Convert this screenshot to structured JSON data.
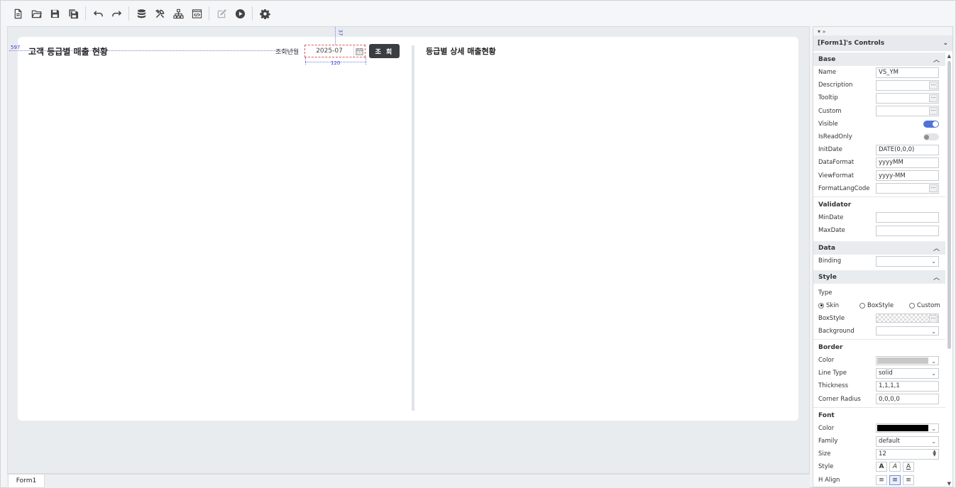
{
  "toolbar": {
    "buttons": [
      {
        "name": "new-file",
        "icon": "new-file-icon"
      },
      {
        "name": "open",
        "icon": "folder-open-icon"
      },
      {
        "name": "save",
        "icon": "save-icon"
      },
      {
        "name": "save-all",
        "icon": "save-all-icon"
      },
      {
        "name": "undo",
        "icon": "undo-icon"
      },
      {
        "name": "redo",
        "icon": "redo-icon"
      },
      {
        "name": "database",
        "icon": "database-icon"
      },
      {
        "name": "tools",
        "icon": "tools-icon"
      },
      {
        "name": "hierarchy",
        "icon": "hierarchy-icon"
      },
      {
        "name": "code-view",
        "icon": "code-window-icon"
      },
      {
        "name": "edit",
        "icon": "edit-icon"
      },
      {
        "name": "run",
        "icon": "play-icon"
      },
      {
        "name": "settings",
        "icon": "gear-icon"
      }
    ]
  },
  "canvas": {
    "left_title": "고객 등급별 매출 현황",
    "right_title": "등급별 상세 매출현황",
    "search_label": "조회년월",
    "date_value": "2025-07",
    "search_button": "조 회",
    "guide_left": "597",
    "guide_top": "37",
    "guide_width": "120"
  },
  "tabs": [
    {
      "label": "Form1"
    }
  ],
  "properties": {
    "pin_text": "▾ »",
    "header": "[Form1]'s Controls",
    "base": {
      "title": "Base",
      "name_label": "Name",
      "name_value": "VS_YM",
      "description_label": "Description",
      "tooltip_label": "Tooltip",
      "custom_label": "Custom",
      "visible_label": "Visible",
      "readonly_label": "IsReadOnly",
      "initdate_label": "InitDate",
      "initdate_value": "DATE(0,0,0)",
      "dataformat_label": "DataFormat",
      "dataformat_value": "yyyyMM",
      "viewformat_label": "ViewFormat",
      "viewformat_value": "yyyy-MM",
      "formatlang_label": "FormatLangCode"
    },
    "validator": {
      "title": "Validator",
      "mindate_label": "MinDate",
      "maxdate_label": "MaxDate"
    },
    "data": {
      "title": "Data",
      "binding_label": "Binding"
    },
    "style": {
      "title": "Style",
      "type_label": "Type",
      "type_options": [
        "Skin",
        "BoxStyle",
        "Custom"
      ],
      "type_selected": "Skin",
      "boxstyle_label": "BoxStyle",
      "background_label": "Background"
    },
    "border": {
      "title": "Border",
      "color_label": "Color",
      "color_value": "#c8c8c8",
      "linetype_label": "Line Type",
      "linetype_value": "solid",
      "thickness_label": "Thickness",
      "thickness_value": "1,1,1,1",
      "corner_label": "Corner Radius",
      "corner_value": "0,0,0,0"
    },
    "font": {
      "title": "Font",
      "color_label": "Color",
      "color_value": "#000000",
      "family_label": "Family",
      "family_value": "default",
      "size_label": "Size",
      "size_value": "12",
      "style_label": "Style",
      "halign_label": "H Align"
    }
  }
}
